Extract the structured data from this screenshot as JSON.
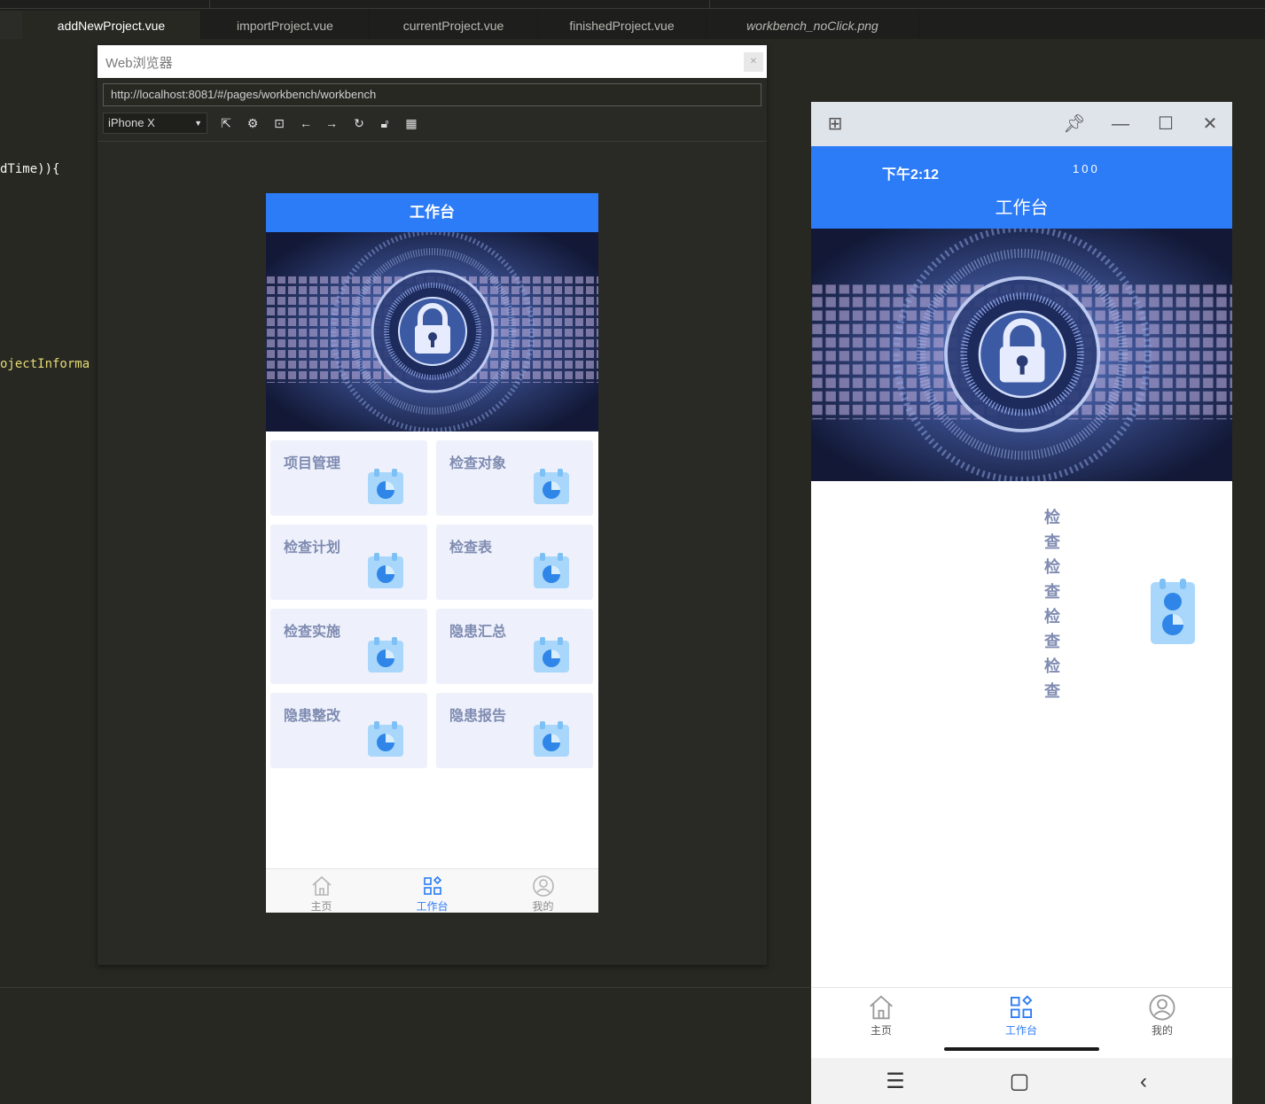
{
  "editor": {
    "tabs": [
      {
        "label": "addNewProject.vue",
        "active": true
      },
      {
        "label": "importProject.vue"
      },
      {
        "label": "currentProject.vue"
      },
      {
        "label": "finishedProject.vue"
      },
      {
        "label": "workbench_noClick.png"
      }
    ],
    "code_lines": [
      "dTime)){",
      "ojectInforma"
    ]
  },
  "web_browser": {
    "title": "Web浏览器",
    "url": "http://localhost:8081/#/pages/workbench/workbench",
    "device": "iPhone X",
    "tools": [
      "external-link-icon",
      "gear-icon",
      "terminal-icon",
      "arrow-left-icon",
      "arrow-right-icon",
      "refresh-icon",
      "lock-icon",
      "qr-code-icon"
    ]
  },
  "app": {
    "header_title": "工作台",
    "cards": [
      "项目管理",
      "检查对象",
      "检查计划",
      "检查表",
      "检查实施",
      "隐患汇总",
      "隐患整改",
      "隐患报告"
    ],
    "tabbar": [
      {
        "label": "主页",
        "icon": "home-icon"
      },
      {
        "label": "工作台",
        "icon": "workbench-icon",
        "active": true
      },
      {
        "label": "我的",
        "icon": "user-icon"
      }
    ],
    "accent_color": "#2c7bf7",
    "card_text_color": "#7f8bb1"
  },
  "phone_mirror": {
    "status_time": "下午2:12",
    "status_right": "100",
    "header_title": "工作台",
    "vertical_text": [
      "检查",
      "检查",
      "检查",
      "检查"
    ],
    "tabbar": [
      {
        "label": "主页"
      },
      {
        "label": "工作台",
        "active": true
      },
      {
        "label": "我的"
      }
    ]
  }
}
